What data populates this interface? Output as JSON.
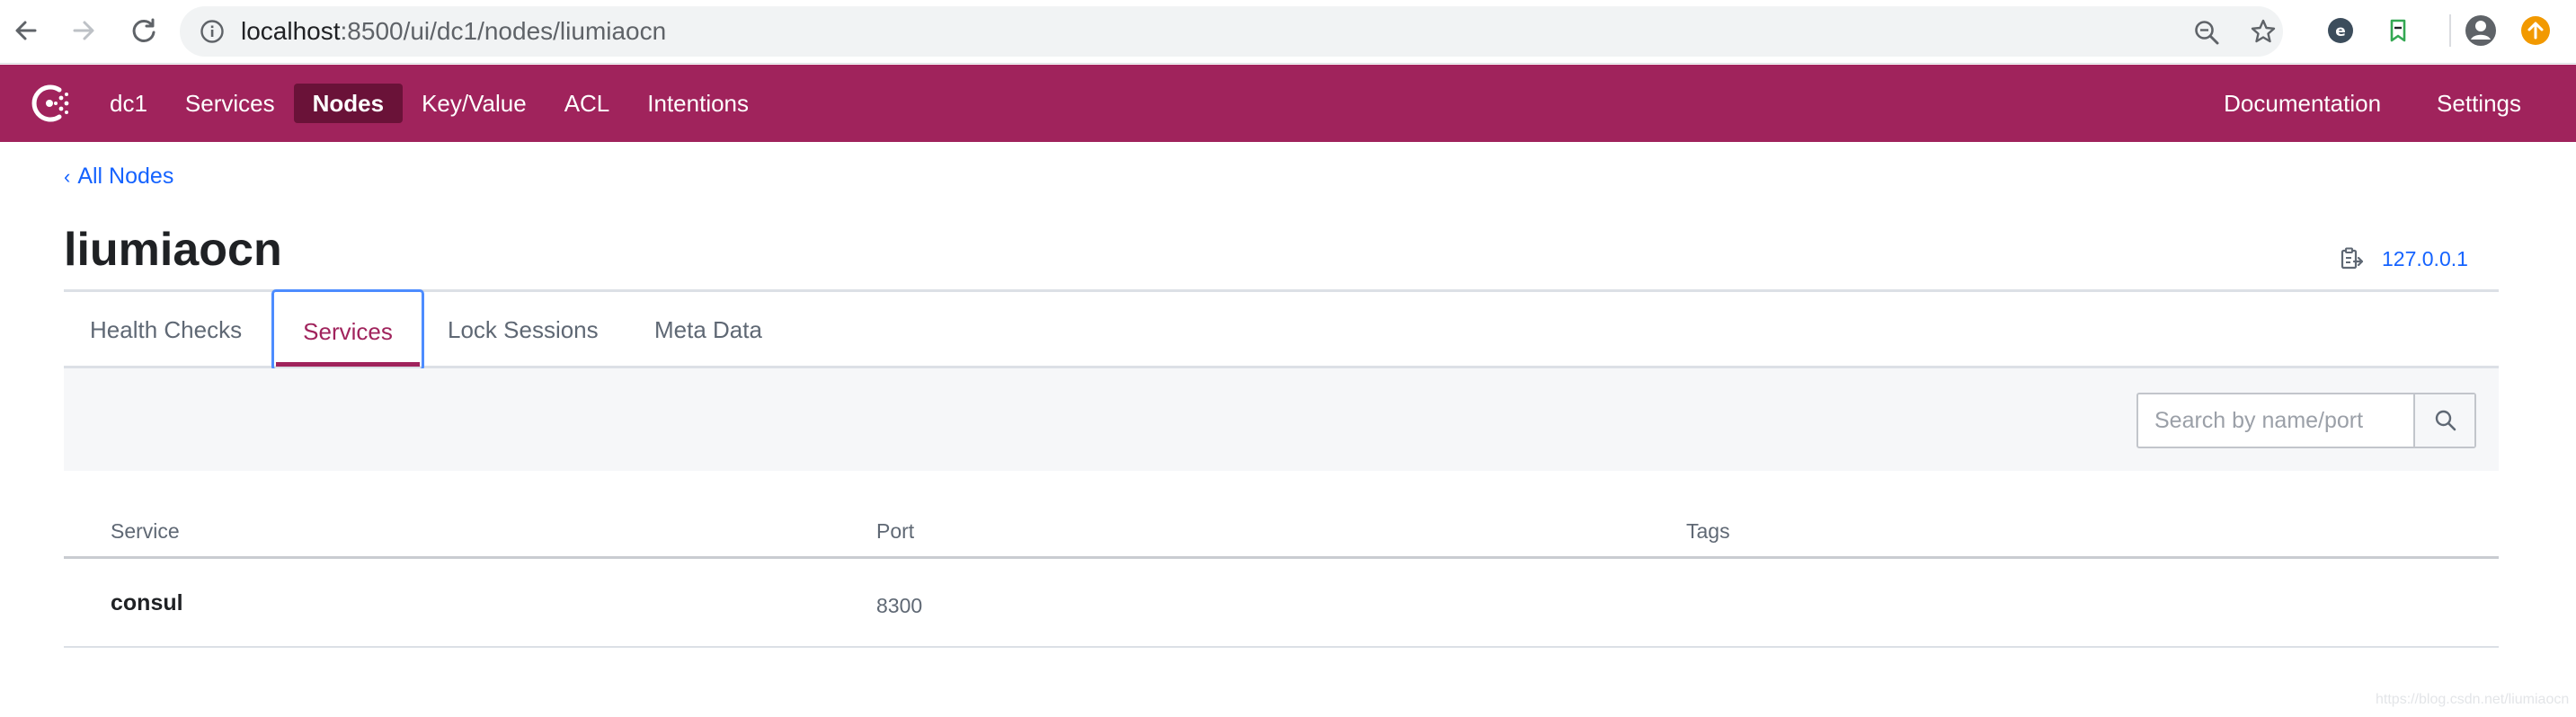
{
  "browser": {
    "url_host": "localhost",
    "url_path": ":8500/ui/dc1/nodes/liumiaocn",
    "icons": [
      "back-arrow-icon",
      "forward-arrow-icon",
      "reload-icon",
      "info-icon",
      "zoom-icon",
      "star-icon",
      "extension-icon",
      "profile-icon",
      "update-icon"
    ]
  },
  "header": {
    "datacenter": "dc1",
    "nav": [
      {
        "label": "Services",
        "active": false
      },
      {
        "label": "Nodes",
        "active": true
      },
      {
        "label": "Key/Value",
        "active": false
      },
      {
        "label": "ACL",
        "active": false
      },
      {
        "label": "Intentions",
        "active": false
      }
    ],
    "right_nav": [
      {
        "label": "Documentation"
      },
      {
        "label": "Settings"
      }
    ],
    "brand_color": "#a0235c",
    "active_nav_color": "#6a1238"
  },
  "page": {
    "breadcrumb": "All Nodes",
    "breadcrumb_chevron": "‹",
    "title": "liumiaocn",
    "address": "127.0.0.1"
  },
  "tabs": [
    {
      "label": "Health Checks",
      "selected": false
    },
    {
      "label": "Services",
      "selected": true
    },
    {
      "label": "Lock Sessions",
      "selected": false
    },
    {
      "label": "Meta Data",
      "selected": false
    }
  ],
  "search": {
    "placeholder": "Search by name/port",
    "value": ""
  },
  "table": {
    "columns": [
      "Service",
      "Port",
      "Tags"
    ],
    "rows": [
      {
        "service": "consul",
        "port": "8300",
        "tags": ""
      }
    ]
  },
  "watermark": "https://blog.csdn.net/liumiaocn",
  "colors": {
    "link": "#1563ff",
    "focus_ring": "#4d8cff"
  }
}
